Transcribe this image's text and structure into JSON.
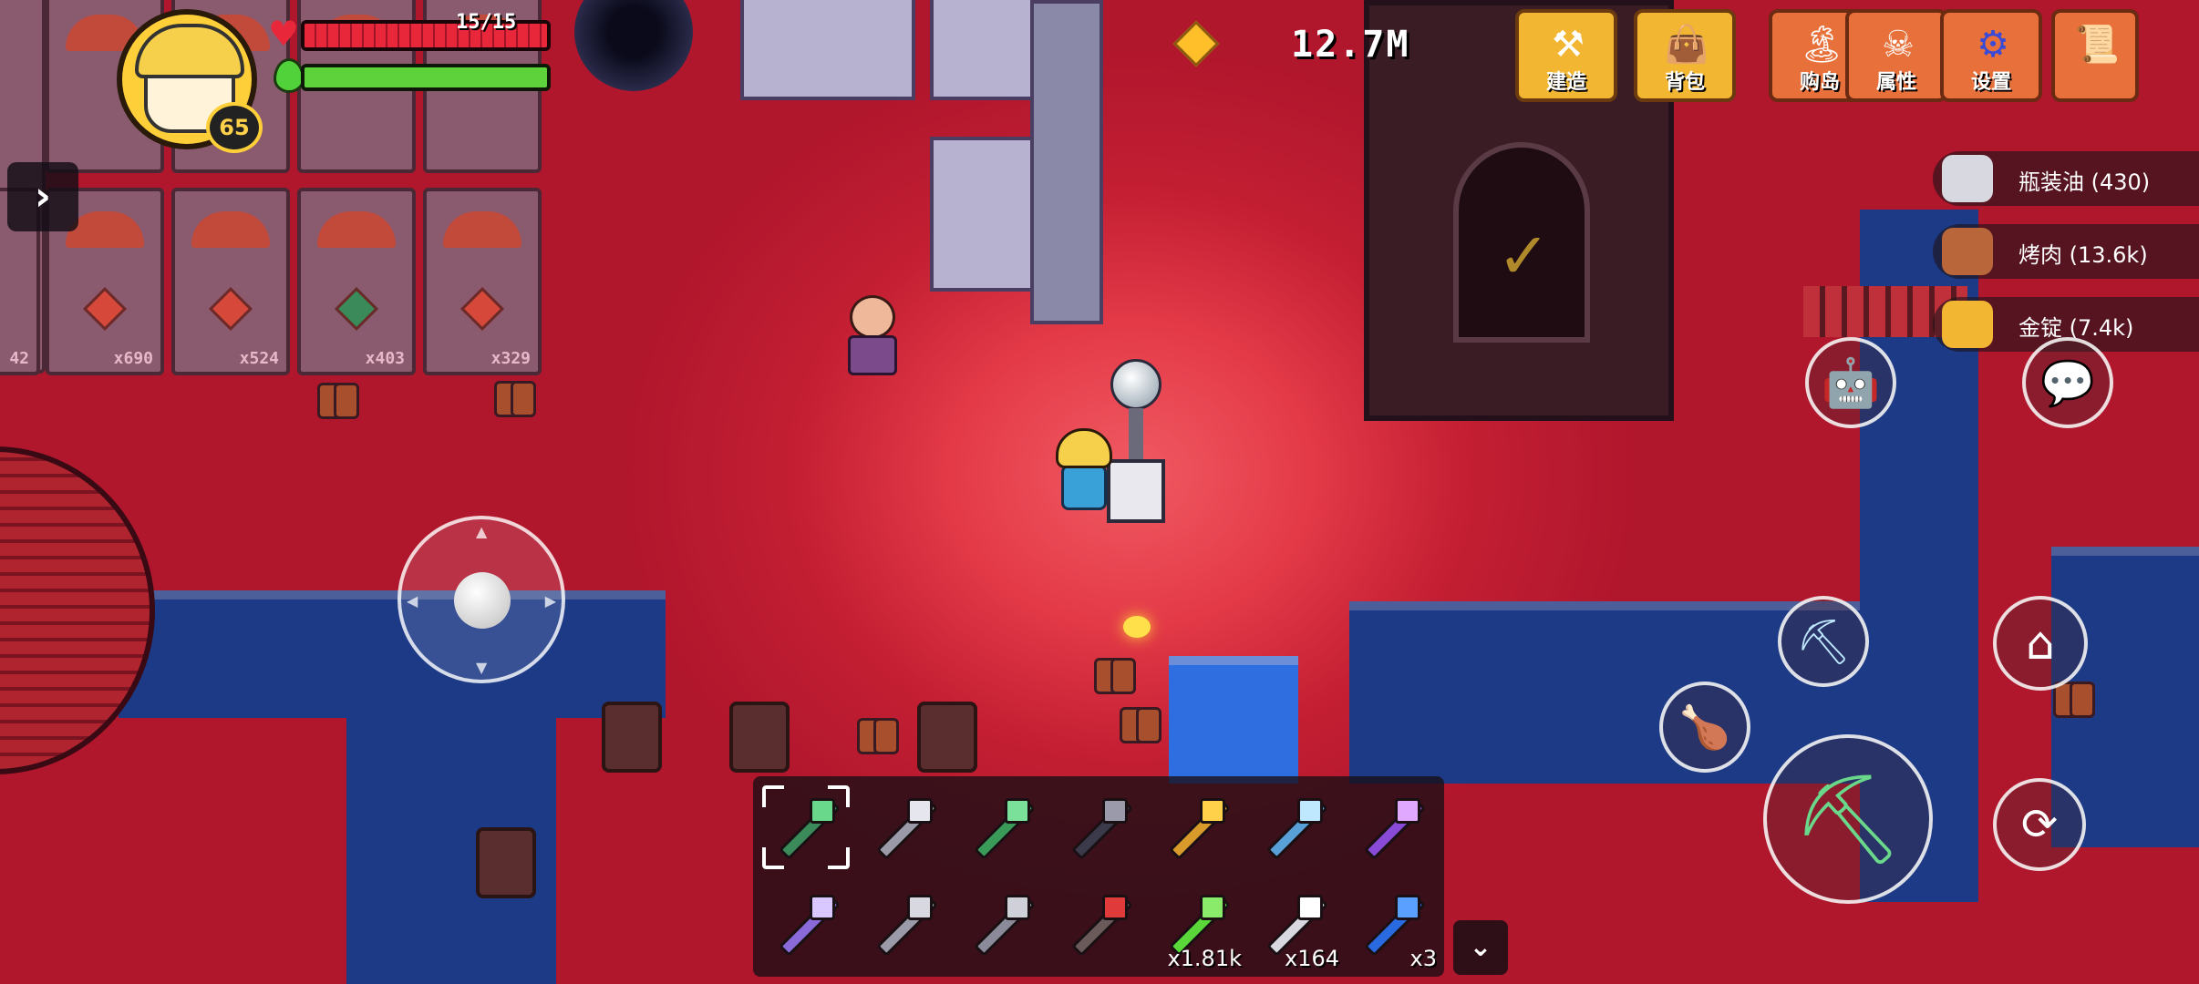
{
  "player": {
    "level": "65",
    "hp_text": "15/15",
    "hp_fraction": 1.0,
    "energy_fraction": 1.0
  },
  "currency": {
    "amount": "12.7M",
    "icon": "gold-diamond-icon"
  },
  "top_menu": {
    "build": "建造",
    "backpack": "背包",
    "buy_island": "购岛",
    "attributes": "属性",
    "settings": "设置"
  },
  "resources": [
    {
      "name": "瓶装油 (430)",
      "icon": "bottled-oil-icon",
      "color": "#d8d8e0"
    },
    {
      "name": "烤肉 (13.6k)",
      "icon": "roast-meat-icon",
      "color": "#b8663a"
    },
    {
      "name": "金锭 (7.4k)",
      "icon": "gold-ingot-icon",
      "color": "#f2b632"
    }
  ],
  "buildings": [
    {
      "qty": "42"
    },
    {
      "qty": "x690"
    },
    {
      "qty": "x524"
    },
    {
      "qty": "x403"
    },
    {
      "qty": "x329"
    }
  ],
  "hotbar": {
    "row1": [
      {
        "name": "emerald-crossbow",
        "body": "#3a8a5a",
        "head": "#6ad88a",
        "selected": true
      },
      {
        "name": "steel-shovel",
        "body": "#9a9aa8",
        "head": "#e6e6ee"
      },
      {
        "name": "emerald-sword",
        "body": "#3a9a5a",
        "head": "#7ae09a"
      },
      {
        "name": "dark-bow",
        "body": "#3a3a4a",
        "head": "#9a9aaa"
      },
      {
        "name": "gold-sword",
        "body": "#d89a2a",
        "head": "#ffd04a"
      },
      {
        "name": "crystal-pickaxe",
        "body": "#5aa0d8",
        "head": "#bfe8ff"
      },
      {
        "name": "amethyst-sword",
        "body": "#8a4ad8",
        "head": "#e0a8ff"
      }
    ],
    "row2": [
      {
        "name": "purple-net",
        "body": "#8a6ad8",
        "head": "#d8c8ff",
        "count": ""
      },
      {
        "name": "drill",
        "body": "#9a9aa8",
        "head": "#d8d8e0",
        "count": ""
      },
      {
        "name": "hammer",
        "body": "#8a8a98",
        "head": "#d0d0d8",
        "count": ""
      },
      {
        "name": "fishing-rod",
        "body": "#6a5a5a",
        "head": "#e03a3a",
        "count": ""
      },
      {
        "name": "green-block",
        "body": "#5ad83a",
        "head": "#8aea6a",
        "count": "x1.81k"
      },
      {
        "name": "jar",
        "body": "#d8d8e0",
        "head": "#ffffff",
        "count": "x164"
      },
      {
        "name": "blue-bomb",
        "body": "#2a6ae0",
        "head": "#5aa0ff",
        "count": "x3"
      }
    ]
  },
  "colors": {
    "hp": "#e8283a",
    "energy": "#5ed23a",
    "button_gold": "#f2b632",
    "button_orange": "#e8703a"
  }
}
